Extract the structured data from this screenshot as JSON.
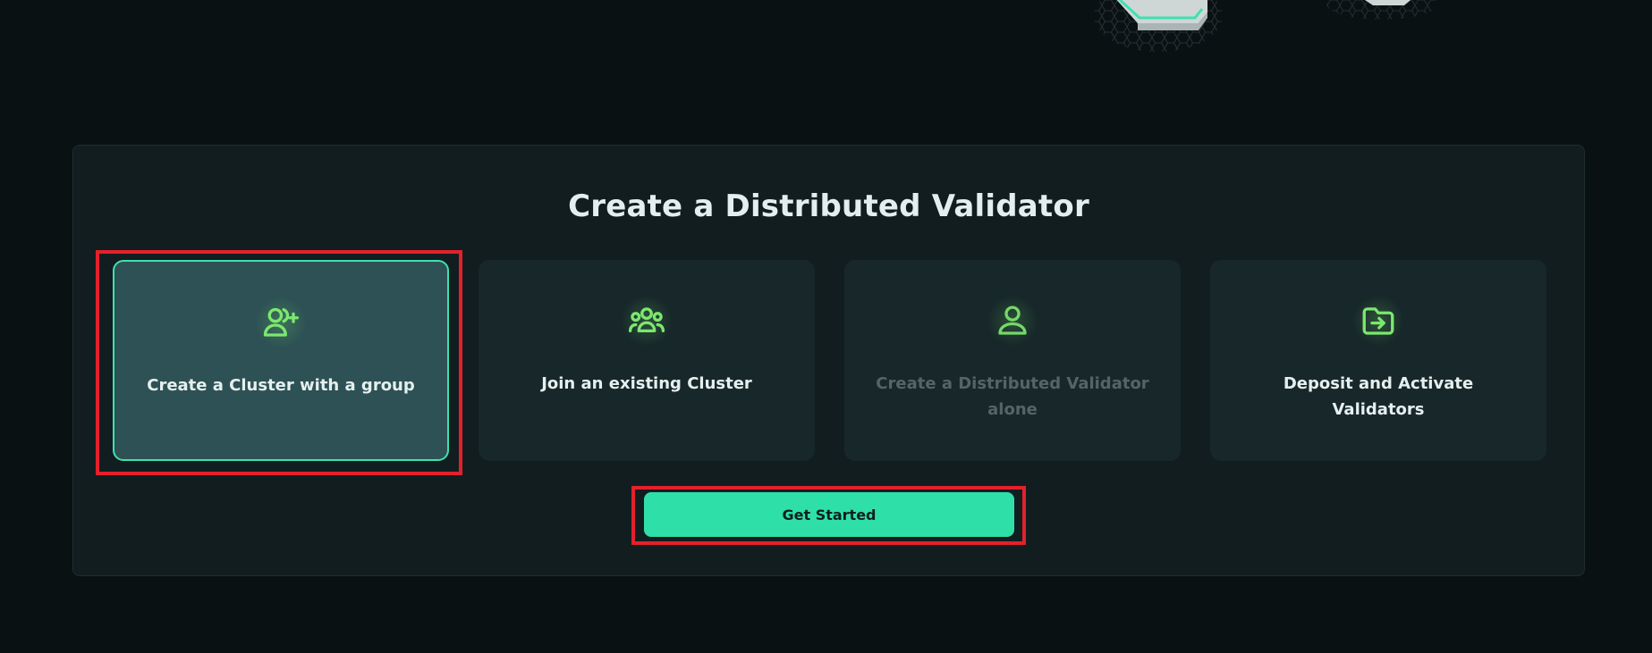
{
  "header": {
    "art_icon": "validator-nodes-illustration"
  },
  "panel": {
    "title": "Create a Distributed Validator",
    "options": [
      {
        "label": "Create a Cluster with a group",
        "icon": "user-plus-icon",
        "state": "selected"
      },
      {
        "label": "Join an existing Cluster",
        "icon": "users-group-icon",
        "state": "default"
      },
      {
        "label": "Create a Distributed Validator alone",
        "icon": "user-icon",
        "state": "disabled"
      },
      {
        "label": "Deposit and Activate Validators",
        "icon": "folder-arrow-icon",
        "state": "default"
      }
    ]
  },
  "actions": {
    "get_started_label": "Get Started"
  },
  "colors": {
    "background": "#0a1113",
    "panel": "#121d20",
    "card": "#17272a",
    "card_selected": "#2d5154",
    "accent": "#2ee0a8",
    "icon_green": "#7ce86e",
    "highlight": "#e3212b"
  }
}
